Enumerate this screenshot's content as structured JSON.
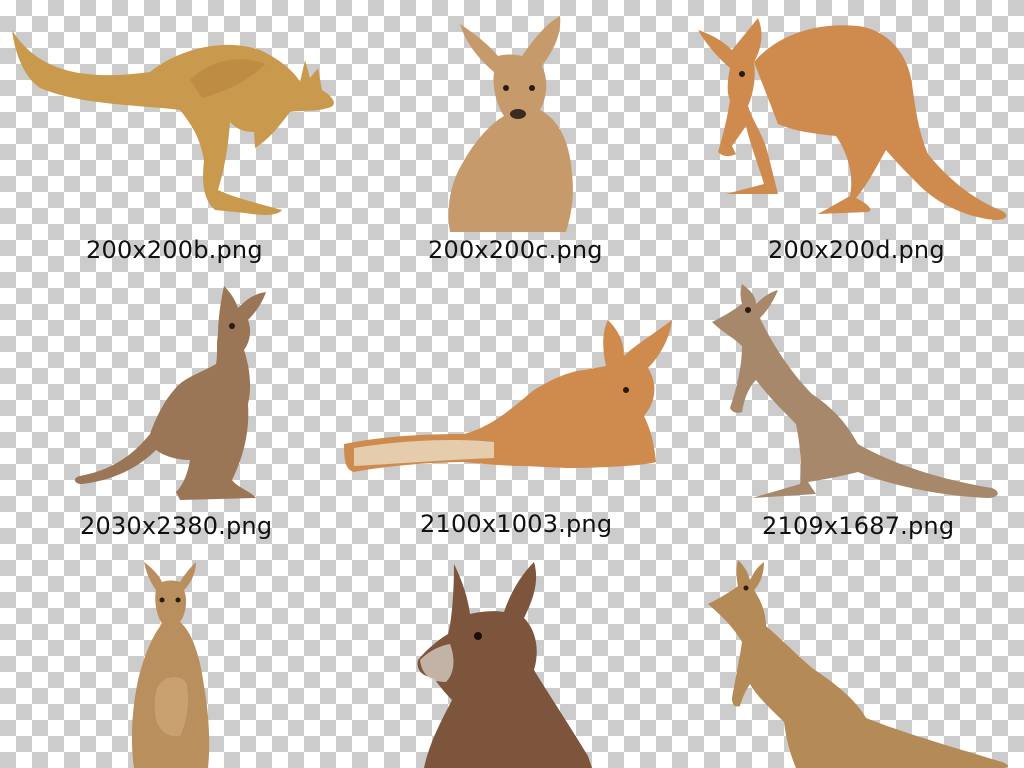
{
  "files": [
    {
      "filename": "200x200b.png",
      "icon": "kangaroo-hopping-icon"
    },
    {
      "filename": "200x200c.png",
      "icon": "kangaroo-upright-icon"
    },
    {
      "filename": "200x200d.png",
      "icon": "kangaroo-standing-side-icon"
    },
    {
      "filename": "2030x2380.png",
      "icon": "kangaroo-standing-icon"
    },
    {
      "filename": "2100x1003.png",
      "icon": "kangaroo-lying-icon"
    },
    {
      "filename": "2109x1687.png",
      "icon": "kangaroo-standing-profile-icon"
    },
    {
      "icon": "kangaroo-with-joey-icon"
    },
    {
      "icon": "kangaroo-head-icon"
    },
    {
      "icon": "kangaroo-cartoon-icon"
    }
  ],
  "colors": {
    "checker_light": "#ffffff",
    "checker_dark": "#cccccc",
    "caption_text": "#111111",
    "fur_gold": "#c99a4e",
    "fur_tan": "#c79a6c",
    "fur_rust": "#cf8a4e",
    "fur_brown": "#9b7656",
    "fur_grey_brown": "#a8886a",
    "fur_dark": "#7d543c"
  }
}
